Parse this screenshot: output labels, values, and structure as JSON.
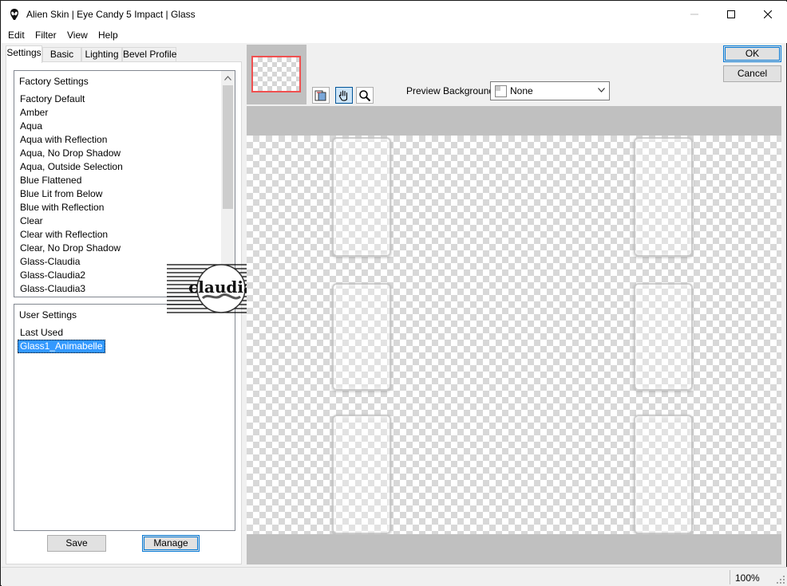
{
  "window": {
    "title": "Alien Skin | Eye Candy 5 Impact | Glass"
  },
  "menu": [
    "Edit",
    "Filter",
    "View",
    "Help"
  ],
  "tabs": [
    "Settings",
    "Basic",
    "Lighting",
    "Bevel Profile"
  ],
  "factory": {
    "header": "Factory Settings",
    "items": [
      "Factory Default",
      "Amber",
      "Aqua",
      "Aqua with Reflection",
      "Aqua, No Drop Shadow",
      "Aqua, Outside Selection",
      "Blue Flattened",
      "Blue Lit from Below",
      "Blue with Reflection",
      "Clear",
      "Clear with Reflection",
      "Clear, No Drop Shadow",
      "Glass-Claudia",
      "Glass-Claudia2",
      "Glass-Claudia3"
    ]
  },
  "user": {
    "header": "User Settings",
    "items": [
      "Last Used",
      "Glass1_Animabelle"
    ],
    "selected": "Glass1_Animabelle"
  },
  "buttons": {
    "save": "Save",
    "manage": "Manage",
    "ok": "OK",
    "cancel": "Cancel"
  },
  "preview_background": {
    "label": "Preview Background:",
    "value": "None"
  },
  "watermark": {
    "text": "claudia"
  },
  "status": {
    "zoom": "100%"
  },
  "icons": {
    "app": "alien-skin-icon",
    "tools": [
      "compare-icon",
      "hand-pan-icon",
      "zoom-magnifier-icon"
    ]
  },
  "colors": {
    "accent": "#0078d7",
    "selection": "#3399ff",
    "thumbnail_border": "#f05050"
  }
}
